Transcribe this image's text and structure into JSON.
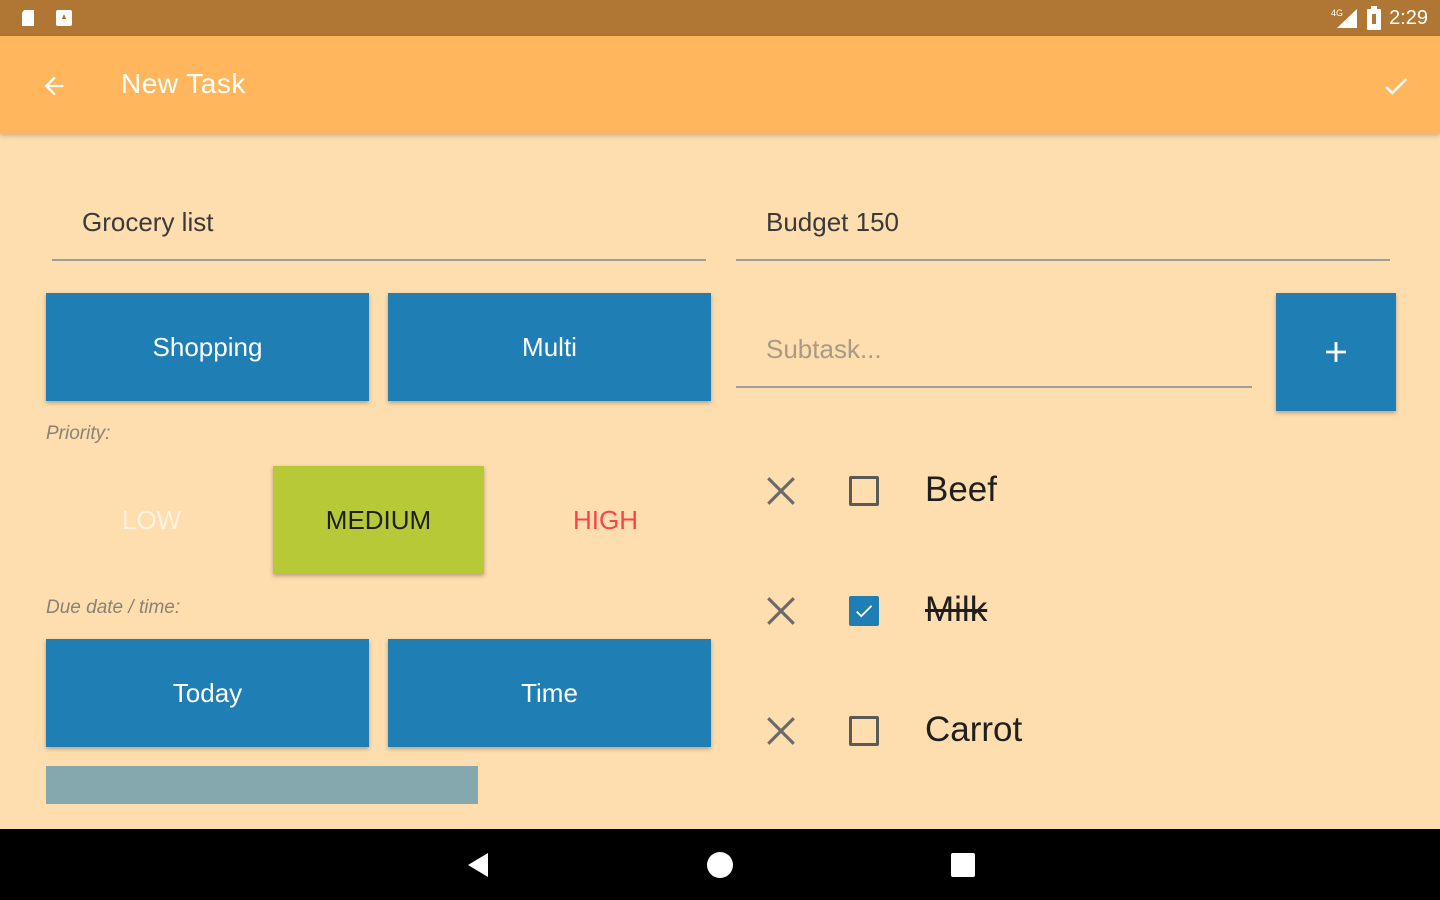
{
  "status_bar": {
    "time": "2:29",
    "left_icons": [
      "sd-card-icon",
      "android-notification-icon"
    ],
    "right_icons": [
      "signal-icon",
      "battery-icon"
    ],
    "network_label": "4G"
  },
  "app_bar": {
    "title": "New Task",
    "back_icon": "arrow-back-icon",
    "save_icon": "check-icon"
  },
  "form": {
    "title_value": "Grocery list",
    "description_value": "Budget 150",
    "category_button": "Shopping",
    "type_button": "Multi",
    "priority_label": "Priority:",
    "priority": {
      "low": "LOW",
      "medium": "MEDIUM",
      "high": "HIGH",
      "selected": "MEDIUM"
    },
    "due_label": "Due date / time:",
    "date_button": "Today",
    "time_button": "Time"
  },
  "subtasks": {
    "input_placeholder": "Subtask...",
    "add_button_icon": "plus-icon",
    "items": [
      {
        "label": "Beef",
        "checked": false
      },
      {
        "label": "Milk",
        "checked": true
      },
      {
        "label": "Carrot",
        "checked": false
      }
    ]
  },
  "colors": {
    "background": "#FEDDAE",
    "status_bar": "#AF7634",
    "app_bar": "#FFB65C",
    "button_blue": "#1F7EB3",
    "medium_green": "#B8C938",
    "high_red": "#F5464E",
    "grey_bar": "#84A8AE"
  },
  "nav_bar": {
    "buttons": [
      "back-triangle-icon",
      "home-circle-icon",
      "recents-square-icon"
    ]
  }
}
